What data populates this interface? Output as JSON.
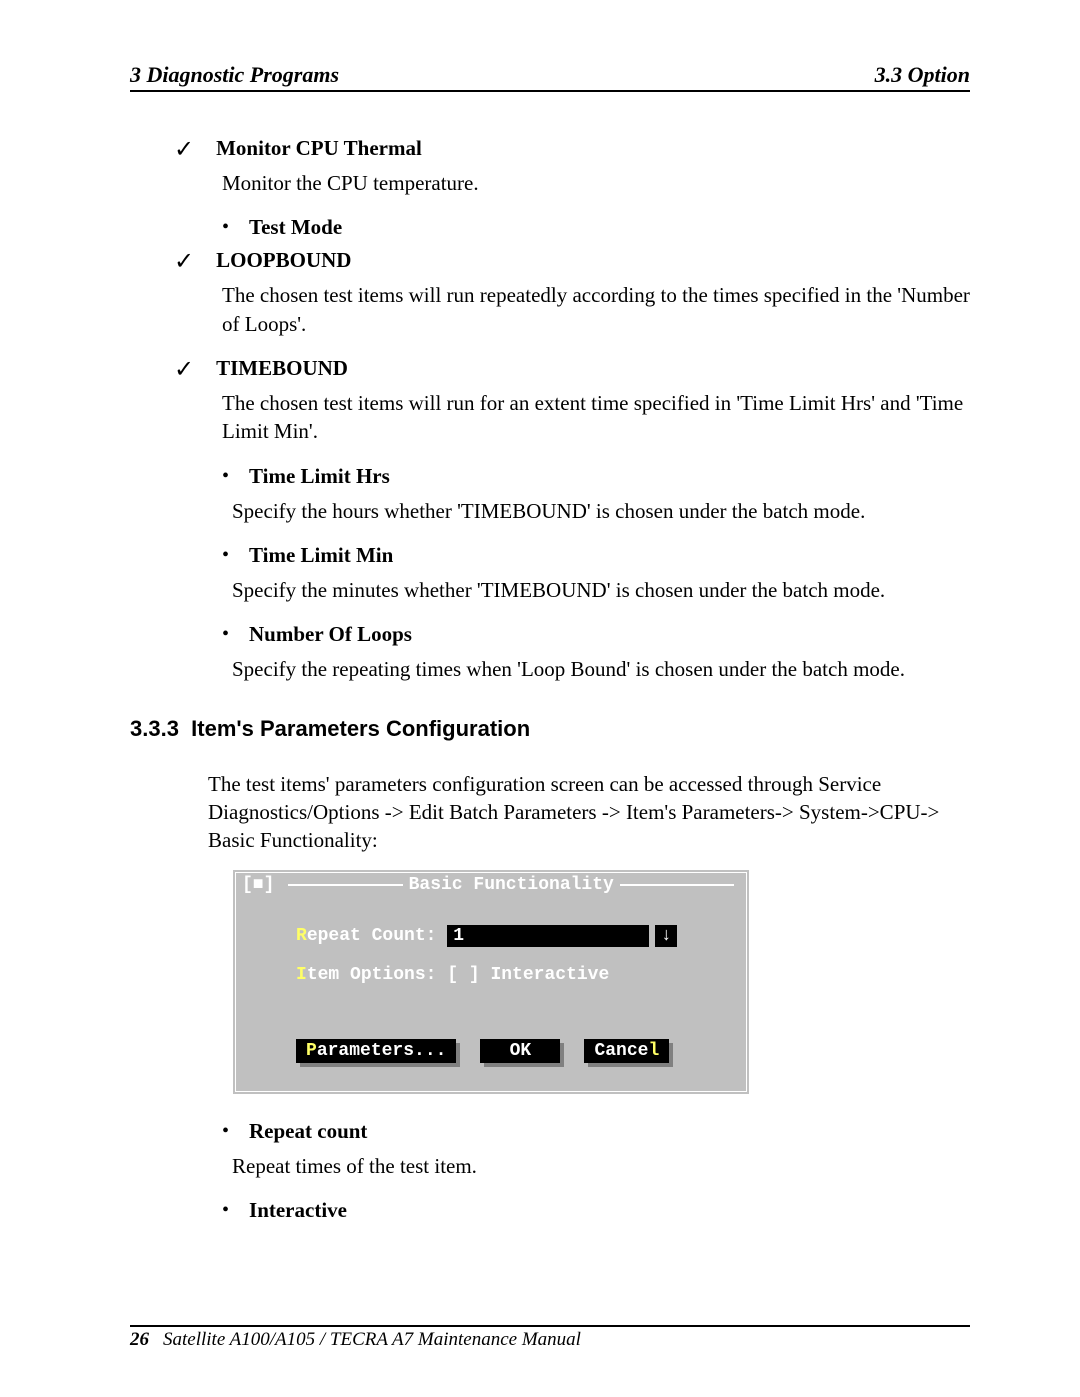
{
  "header": {
    "left": "3  Diagnostic Programs",
    "right": "3.3 Option"
  },
  "items": {
    "check1_label": "Monitor CPU Thermal",
    "check1_body": "Monitor the CPU temperature.",
    "bullet_testmode": "Test Mode",
    "check2_label": "LOOPBOUND",
    "check2_body": "The chosen test items will run repeatedly according to the times specified in the 'Number of Loops'.",
    "check3_label": "TIMEBOUND",
    "check3_body": "The chosen test items will run for an extent time specified in 'Time Limit Hrs' and 'Time Limit Min'.",
    "bullet_hrs_label": "Time Limit Hrs",
    "bullet_hrs_body": "Specify the hours whether 'TIMEBOUND' is chosen under the batch mode.",
    "bullet_min_label": "Time Limit Min",
    "bullet_min_body": "Specify the minutes whether 'TIMEBOUND' is chosen under the batch mode.",
    "bullet_loops_label": "Number Of Loops",
    "bullet_loops_body": "Specify the repeating times when 'Loop Bound' is chosen under the batch mode."
  },
  "section": {
    "number": "3.3.3",
    "title": "Item's Parameters Configuration",
    "intro": "The test items' parameters configuration screen can be accessed through Service Diagnostics/Options -> Edit Batch Parameters -> Item's Parameters-> System->CPU-> Basic Functionality:"
  },
  "terminal": {
    "corner": "[■]",
    "title": "Basic Functionality",
    "repeat_label_pre": "R",
    "repeat_label_rest": "epeat Count:",
    "repeat_value": "1",
    "spinner": "↓",
    "item_label_pre": "I",
    "item_label_rest": "tem Options:",
    "item_check": "[ ] Interactive",
    "btn_param_pre": "P",
    "btn_param_rest": "arameters...",
    "btn_ok": "OK",
    "btn_cancel_pre": "Cance",
    "btn_cancel_rest": "l"
  },
  "post": {
    "bullet_repeat_label": "Repeat count",
    "bullet_repeat_body": "Repeat times of the test item.",
    "bullet_interactive_label": "Interactive"
  },
  "footer": {
    "page": "26",
    "text": "Satellite A100/A105 / TECRA A7 Maintenance Manual"
  }
}
